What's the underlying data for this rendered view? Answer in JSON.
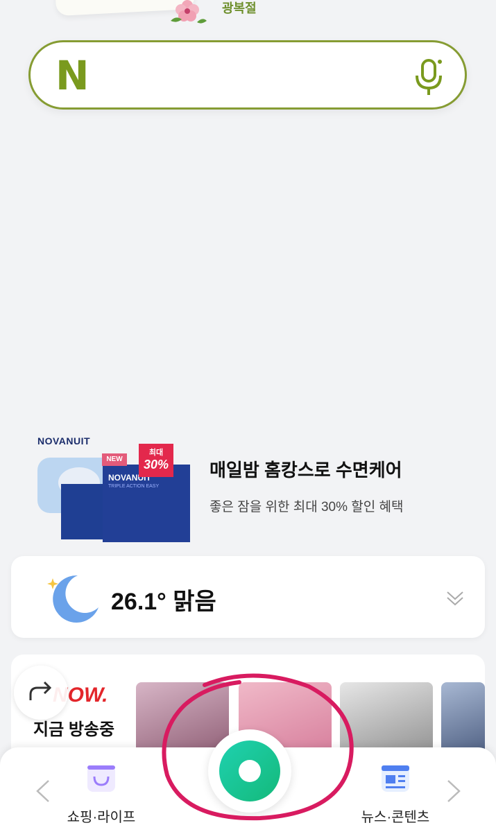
{
  "header": {
    "holiday_label": "광복절"
  },
  "search": {
    "logo_letter": "N"
  },
  "ad": {
    "brand": "NOVANUIT",
    "product_name": "NOVANUIT",
    "product_sub": "TRIPLE ACTION EASY",
    "badge_new": "NEW",
    "badge_discount_top": "최대",
    "badge_discount_value": "30%",
    "title": "매일밤 홈캉스로 수면케어",
    "description": "좋은 잠을 위한 최대 30% 할인 혜택"
  },
  "weather": {
    "temperature": "26.1°",
    "condition": "맑음",
    "icon": "crescent-moon-icon"
  },
  "now": {
    "logo": "NOW.",
    "label": "지금 방송중",
    "thumbnails": [
      {
        "caption": "",
        "color": "#b98fa6"
      },
      {
        "caption": "",
        "color": "#e2a0b4"
      },
      {
        "caption": "",
        "color": "#c8c8c8"
      },
      {
        "caption": "",
        "color": "#7a8fb0"
      }
    ]
  },
  "bottom_nav": {
    "left_label": "쇼핑·라이프",
    "right_label": "뉴스·콘텐츠"
  },
  "colors": {
    "brand_green": "#7a9a1e",
    "search_border": "#869c33",
    "center_button": "#14b97a",
    "annotation": "#d81b60"
  }
}
